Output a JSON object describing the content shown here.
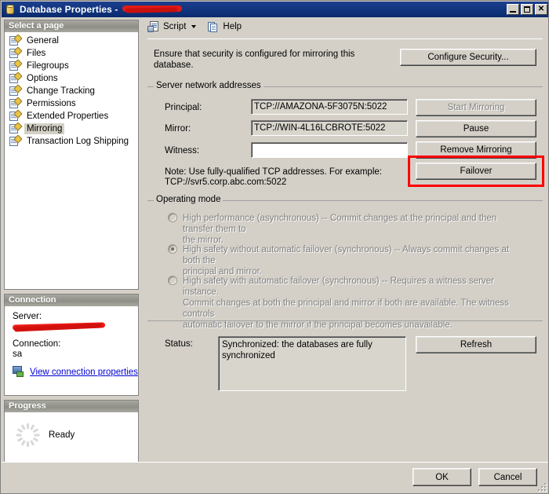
{
  "window": {
    "title_prefix": "Database Properties - ",
    "db_name_redacted": true,
    "icon": "database-cylinder-icon",
    "minimize": "Minimize",
    "maximize": "Maximize",
    "close": "Close"
  },
  "toolbar": {
    "script_label": "Script",
    "help_label": "Help"
  },
  "sidebar": {
    "select_page_header": "Select a page",
    "pages": [
      {
        "label": "General",
        "selected": false
      },
      {
        "label": "Files",
        "selected": false
      },
      {
        "label": "Filegroups",
        "selected": false
      },
      {
        "label": "Options",
        "selected": false
      },
      {
        "label": "Change Tracking",
        "selected": false
      },
      {
        "label": "Permissions",
        "selected": false
      },
      {
        "label": "Extended Properties",
        "selected": false
      },
      {
        "label": "Mirroring",
        "selected": true
      },
      {
        "label": "Transaction Log Shipping",
        "selected": false
      }
    ],
    "connection": {
      "header": "Connection",
      "server_label": "Server:",
      "server_value_redacted": true,
      "connection_label": "Connection:",
      "connection_value": "sa",
      "view_properties_link": "View connection properties"
    },
    "progress": {
      "header": "Progress",
      "status": "Ready"
    }
  },
  "main": {
    "intro": "Ensure that security is configured for mirroring this database.",
    "configure_security_button": "Configure Security...",
    "server_network_addresses": {
      "legend": "Server network addresses",
      "principal_label": "Principal:",
      "principal_value": "TCP://AMAZONA-5F3075N:5022",
      "mirror_label": "Mirror:",
      "mirror_value": "TCP://WIN-4L16LCBROTE:5022",
      "witness_label": "Witness:",
      "witness_value": "",
      "note_line1": "Note: Use fully-qualified TCP addresses. For example:",
      "note_line2": "TCP://svr5.corp.abc.com:5022"
    },
    "mirroring_buttons": [
      {
        "label": "Start Mirroring",
        "disabled": true,
        "highlighted": false
      },
      {
        "label": "Pause",
        "disabled": false,
        "highlighted": false
      },
      {
        "label": "Remove Mirroring",
        "disabled": false,
        "highlighted": false
      },
      {
        "label": "Failover",
        "disabled": false,
        "highlighted": true
      }
    ],
    "operating_mode": {
      "legend": "Operating mode",
      "options": [
        {
          "line1": "High performance (asynchronous) -- Commit changes at the principal and then transfer them to",
          "line2": "the mirror.",
          "line3": "",
          "selected": false,
          "disabled": true
        },
        {
          "line1": "High safety without automatic failover (synchronous) -- Always commit changes at both the",
          "line2": "principal and mirror.",
          "line3": "",
          "selected": true,
          "disabled": true
        },
        {
          "line1": "High safety with automatic failover (synchronous) -- Requires a witness server instance.",
          "line2": "Commit changes at both the principal and mirror if both are available. The witness controls",
          "line3": "automatic failover to the mirror if the principal becomes unavailable.",
          "selected": false,
          "disabled": true
        }
      ]
    },
    "status_section": {
      "label": "Status:",
      "value": "Synchronized: the databases are fully synchronized",
      "refresh_button": "Refresh"
    }
  },
  "footer": {
    "ok_button": "OK",
    "cancel_button": "Cancel"
  },
  "colors": {
    "dialog_bg": "#d4d0c8",
    "titlebar_start": "#1c3f8f",
    "titlebar_end": "#0a2a6e",
    "annotation_red": "#ff0000",
    "redaction_red": "#e01b18",
    "link_blue": "#0000d4",
    "disabled_text": "#808080"
  }
}
